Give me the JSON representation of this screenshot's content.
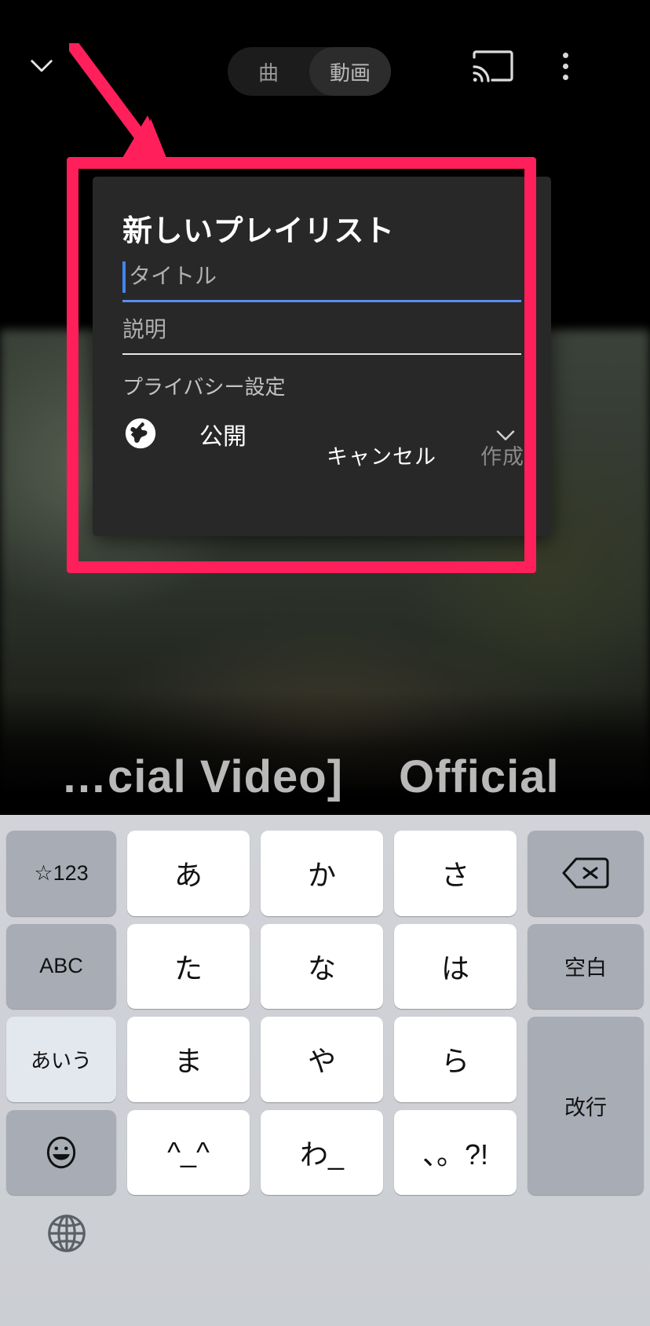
{
  "topbar": {
    "collapse_icon": "chevron-down-icon",
    "segments": [
      {
        "label": "曲",
        "active": false
      },
      {
        "label": "動画",
        "active": true
      }
    ],
    "cast_icon": "cast-icon",
    "overflow_icon": "more-vertical-icon"
  },
  "background": {
    "ghost_text_left": "…cial Video]",
    "ghost_text_right": "Official"
  },
  "dialog": {
    "title": "新しいプレイリスト",
    "title_field": {
      "placeholder": "タイトル",
      "value": "",
      "underline_color": "#5b8def",
      "focused": true
    },
    "description_field": {
      "placeholder": "説明",
      "value": "",
      "underline_color": "#e8e8e8"
    },
    "privacy_label": "プライバシー設定",
    "privacy_value": "公開",
    "privacy_icon": "globe-icon",
    "privacy_chevron": "chevron-down-icon",
    "cancel_label": "キャンセル",
    "create_label": "作成",
    "create_enabled": false
  },
  "annotation": {
    "highlight_color": "#ff1f5a",
    "arrow_icon": "arrow-down-right-icon"
  },
  "keyboard": {
    "rows": [
      [
        {
          "label": "☆123",
          "type": "fn-sm"
        },
        {
          "label": "あ",
          "type": "char"
        },
        {
          "label": "か",
          "type": "char"
        },
        {
          "label": "さ",
          "type": "char"
        },
        {
          "label": "delete-icon",
          "type": "fn-icon"
        }
      ],
      [
        {
          "label": "ABC",
          "type": "fn-sm"
        },
        {
          "label": "た",
          "type": "char"
        },
        {
          "label": "な",
          "type": "char"
        },
        {
          "label": "は",
          "type": "char"
        },
        {
          "label": "空白",
          "type": "fn-sm"
        }
      ],
      [
        {
          "label": "あいう",
          "type": "fn-light"
        },
        {
          "label": "ま",
          "type": "char"
        },
        {
          "label": "や",
          "type": "char"
        },
        {
          "label": "ら",
          "type": "char"
        },
        {
          "label": "改行",
          "type": "fn-sm-span2"
        }
      ],
      [
        {
          "label": "emoji-icon",
          "type": "fn-icon"
        },
        {
          "label": "^_^",
          "type": "char"
        },
        {
          "label": "わ_",
          "type": "char"
        },
        {
          "label": "、。?!",
          "type": "char"
        }
      ]
    ],
    "globe_icon": "globe-keyboard-switch-icon"
  }
}
